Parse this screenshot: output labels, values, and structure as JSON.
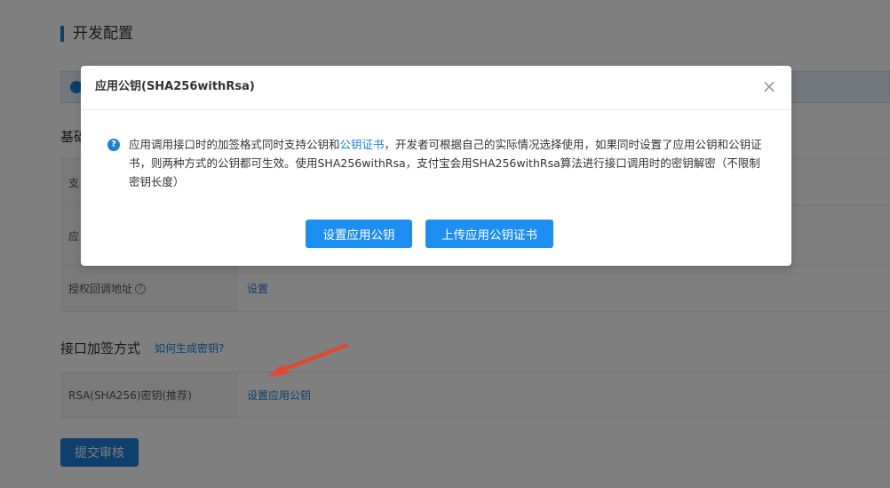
{
  "page": {
    "title": "开发配置",
    "section_basic": "基础",
    "rows_top": [
      {
        "label": "支",
        "value": ""
      },
      {
        "label": "应",
        "value": ""
      }
    ],
    "auth_callback": {
      "label": "授权回调地址",
      "help": "?",
      "value": "设置"
    },
    "section_sign": "接口加签方式",
    "sign_help_link": "如何生成密钥?",
    "rsa_row": {
      "label": "RSA(SHA256)密钥(推荐)",
      "value": "设置应用公钥"
    },
    "submit_label": "提交审核"
  },
  "modal": {
    "title": "应用公钥(SHA256withRsa)",
    "close_icon": "×",
    "info_icon": "?",
    "text_before_link": "应用调用接口时的加签格式同时支持公钥和",
    "text_link": "公钥证书",
    "text_after_link": "，开发者可根据自己的实际情况选择使用，如果同时设置了应用公钥和公钥证书，则两种方式的公钥都可生效。使用SHA256withRsa，支付宝会用SHA256withRsa算法进行接口调用时的密钥解密（不限制密钥长度）",
    "btn_set_key": "设置应用公钥",
    "btn_upload_cert": "上传应用公钥证书"
  },
  "colors": {
    "accent": "#1e7fd8",
    "arrow": "#e5452f"
  }
}
